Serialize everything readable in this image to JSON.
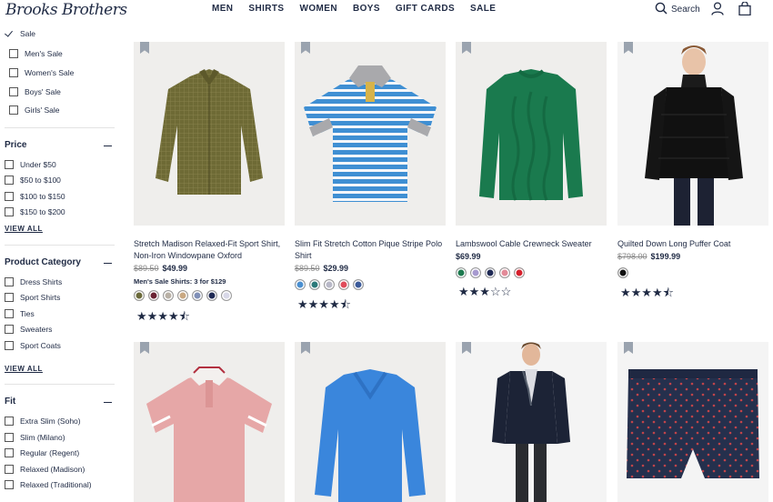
{
  "header": {
    "logo": "Brooks Brothers",
    "nav": [
      "MEN",
      "SHIRTS",
      "WOMEN",
      "BOYS",
      "GIFT CARDS",
      "SALE"
    ],
    "search_label": "Search"
  },
  "sidebar": {
    "sale": {
      "label": "Sale",
      "items": [
        "Men's Sale",
        "Women's Sale",
        "Boys' Sale",
        "Girls' Sale"
      ]
    },
    "price": {
      "title": "Price",
      "items": [
        "Under $50",
        "$50 to $100",
        "$100 to $150",
        "$150 to $200"
      ],
      "view_all": "VIEW ALL"
    },
    "category": {
      "title": "Product Category",
      "items": [
        "Dress Shirts",
        "Sport Shirts",
        "Ties",
        "Sweaters",
        "Sport Coats"
      ],
      "view_all": "VIEW ALL"
    },
    "fit": {
      "title": "Fit",
      "items": [
        "Extra Slim (Soho)",
        "Slim (Milano)",
        "Regular (Regent)",
        "Relaxed (Madison)",
        "Relaxed (Traditional)"
      ]
    }
  },
  "products": [
    {
      "name": "Stretch Madison Relaxed-Fit Sport Shirt, Non-Iron Windowpane Oxford",
      "old_price": "$89.50",
      "price": "$49.99",
      "promo": "Men's Sale Shirts: 3 for $129",
      "swatches": [
        "#6b6a3a",
        "#6a2233",
        "#b9b1a6",
        "#c9a882",
        "#8090b8",
        "#1f2a55",
        "#d8d8e8"
      ],
      "stars": "★★★★⯪",
      "rating": 4.5
    },
    {
      "name": "Slim Fit Stretch Cotton Pique Stripe Polo Shirt",
      "old_price": "$89.50",
      "price": "$29.99",
      "swatches": [
        "#4a8fd0",
        "#2b7a7a",
        "#b9b9c8",
        "#e04b5a",
        "#3b5a9a"
      ],
      "stars": "★★★★⯪",
      "rating": 4.5
    },
    {
      "name": "Lambswool Cable Crewneck Sweater",
      "price": "$69.99",
      "swatches": [
        "#1d7a4f",
        "#a79ad0",
        "#1f2a55",
        "#e38a98",
        "#d61f2c"
      ],
      "stars": "★★★☆☆",
      "rating": 3
    },
    {
      "name": "Quilted Down Long Puffer Coat",
      "old_price": "$798.00",
      "price": "$199.99",
      "swatches": [
        "#111111"
      ],
      "stars": "★★★★⯪",
      "rating": 4.5
    }
  ],
  "colors": {
    "navy": "#1f2a44",
    "image_bg": "#efeeec"
  }
}
